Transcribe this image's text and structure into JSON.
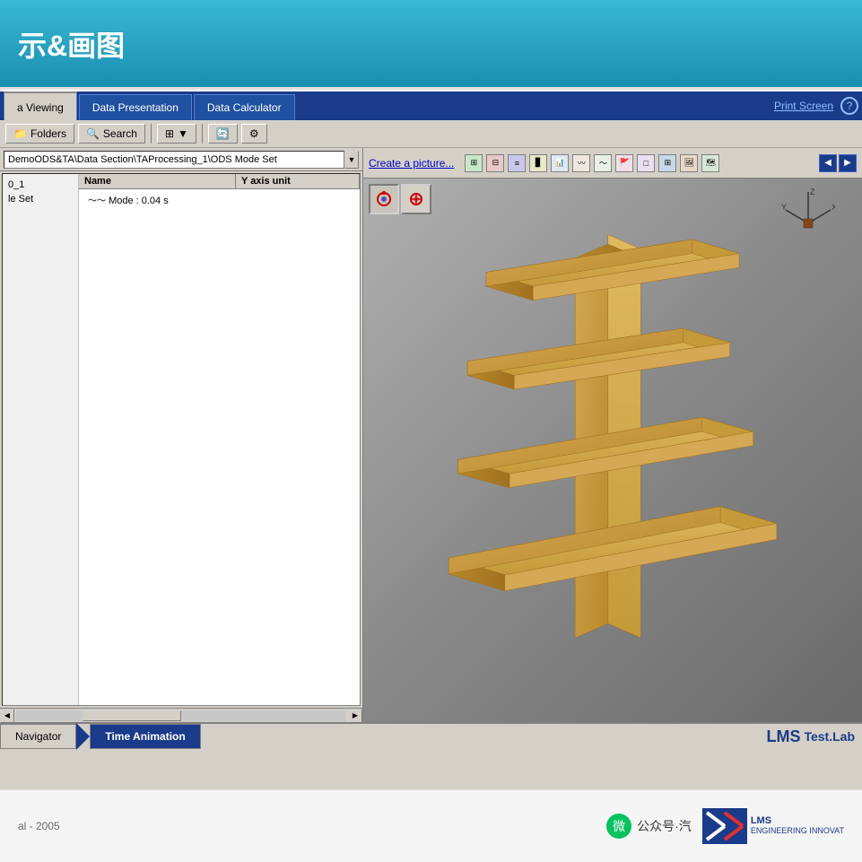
{
  "header": {
    "title": "示&画图",
    "bg_color": "#3ab8d4"
  },
  "tabs": {
    "active": "Data Viewing",
    "items": [
      "a Viewing",
      "Data Presentation",
      "Data Calculator"
    ],
    "print_screen": "Print Screen",
    "help": "?"
  },
  "toolbar": {
    "folders_label": "Folders",
    "search_label": "Search"
  },
  "path_bar": {
    "value": "DemoODS&TA\\Data Section\\TAProcessing_1\\ODS Mode Set"
  },
  "table": {
    "col_name": "Name",
    "col_unit": "Y axis unit",
    "rows": [
      {
        "name": "Mode : 0.04 s",
        "unit": ""
      },
      {
        "name": "_1",
        "unit": ""
      },
      {
        "name": "le Set",
        "unit": ""
      }
    ]
  },
  "picture_toolbar": {
    "create_label": "Create a picture...",
    "icons": [
      "grid1",
      "grid2",
      "grid3",
      "bar1",
      "bar2",
      "wave1",
      "wave2",
      "flag",
      "box",
      "checker",
      "photo",
      "img"
    ]
  },
  "viewport": {
    "bg_start": "#b0b0b0",
    "bg_end": "#6a6a6a"
  },
  "bottom_nav": {
    "navigator_label": "Navigator",
    "time_animation_label": "Time Animation",
    "lms_label": "LMS",
    "testlab_label": "Test.Lab"
  },
  "footer": {
    "copyright": "al - 2005",
    "wechat_label": "公众号·汽",
    "engineering_label": "ENGINEERING INNOVAT"
  },
  "icons": {
    "folder": "📁",
    "search": "🔍",
    "rotate": "↺",
    "left": "◀",
    "right": "▶",
    "axis_x": "X",
    "axis_y": "Y",
    "axis_z": "Z"
  }
}
